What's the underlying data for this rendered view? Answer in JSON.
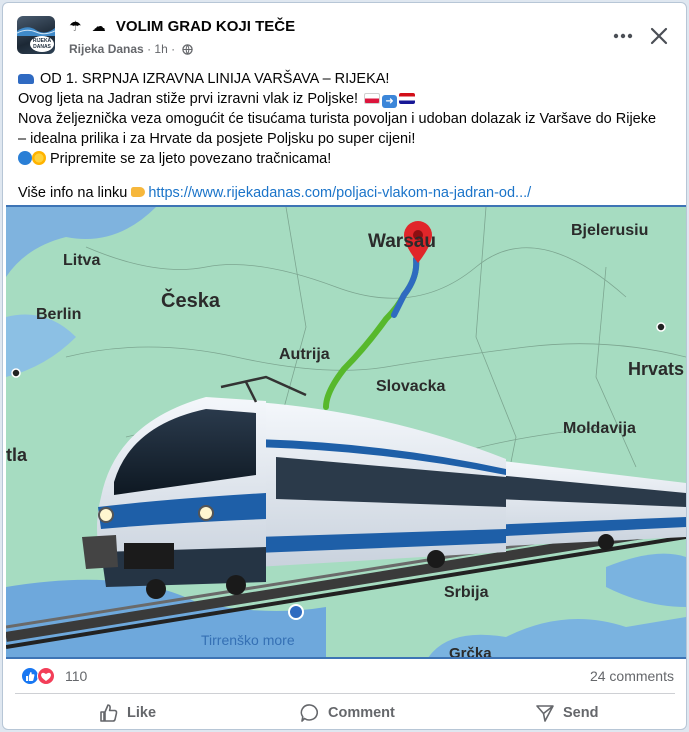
{
  "post": {
    "group_title": "VOLIM GRAD KOJI TEČE",
    "author": "Rijeka Danas",
    "time": "1h",
    "avatar_text": "RIJEKA DANAS",
    "icons": {
      "title_deco": [
        "umbrella-icon",
        "cloud-rain-icon"
      ],
      "privacy": "globe-icon",
      "more": "ellipsis-icon",
      "close": "close-icon"
    },
    "lines": [
      "OD 1. SRPNJA IZRAVNA LINIJA VARŠAVA – RIJEKA!",
      "Ovog ljeta na Jadran stiže prvi izravni vlak iz Poljske!",
      "Nova željeznička veza omogućit će tisućama turista povoljan i udoban dolazak iz Varšave do Rijeke",
      "– idealna prilika i za Hrvate da posjete Poljsku po super cijeni!",
      "Pripremite se za ljeto povezano tračnicama!"
    ],
    "link_prefix": "Više info na linku",
    "link": "https://www.rijekadanas.com/poljaci-vlakom-na-jadran-od.../"
  },
  "map": {
    "labels": {
      "warsaw": "Warsau",
      "belarus": "Bjelerusiu",
      "lithuania": "Litva",
      "czech": "Česka",
      "berlin": "Berlin",
      "austria": "Autrija",
      "slovakia": "Slovacka",
      "croatia": "Hrvats",
      "moldova": "Moldavija",
      "italy_left": "tla",
      "serbia": "Srbija",
      "tyrrhenian": "Tirrenško more",
      "greece": "Grčka"
    },
    "colors": {
      "land": "#a6dcc1",
      "water": "#7fb3de",
      "route_green": "#57b82c",
      "route_blue": "#2f6bc0",
      "pin": "#e0262a"
    }
  },
  "reactions": {
    "count": "110",
    "comments": "24 comments",
    "icons": [
      "like-reaction-icon",
      "love-reaction-icon"
    ]
  },
  "actions": {
    "like": "Like",
    "comment": "Comment",
    "send": "Send"
  }
}
